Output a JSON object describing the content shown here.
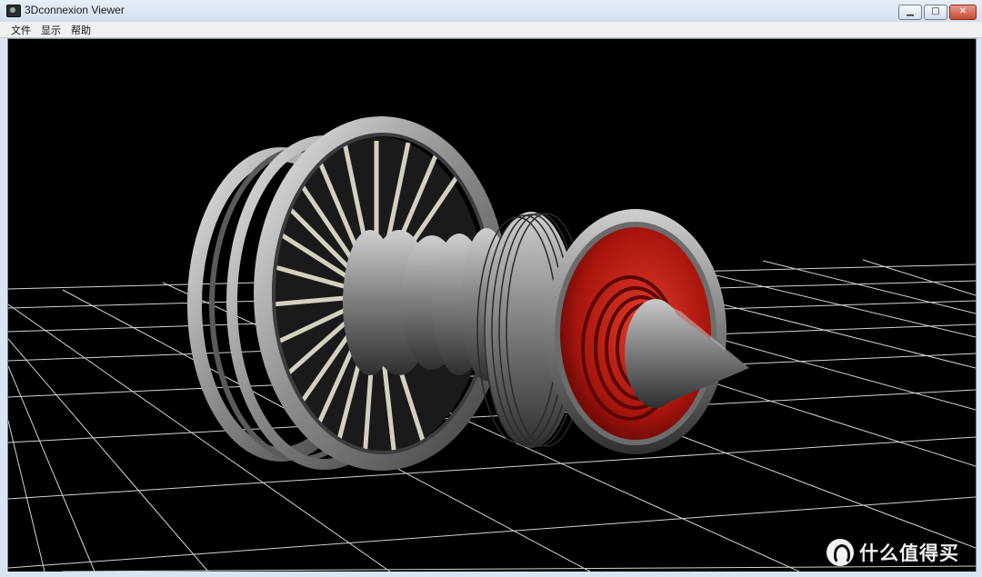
{
  "window": {
    "title": "3Dconnexion Viewer",
    "controls": {
      "minimize": "▁",
      "maximize": "□",
      "close": "✕"
    }
  },
  "menu": {
    "items": [
      "文件",
      "显示",
      "帮助"
    ]
  },
  "scene": {
    "background": "#000000",
    "grid_color": "#d8d8d8",
    "model": "jet-engine",
    "accent_color": "#b0140c"
  },
  "watermark": {
    "text": "什么值得买"
  }
}
